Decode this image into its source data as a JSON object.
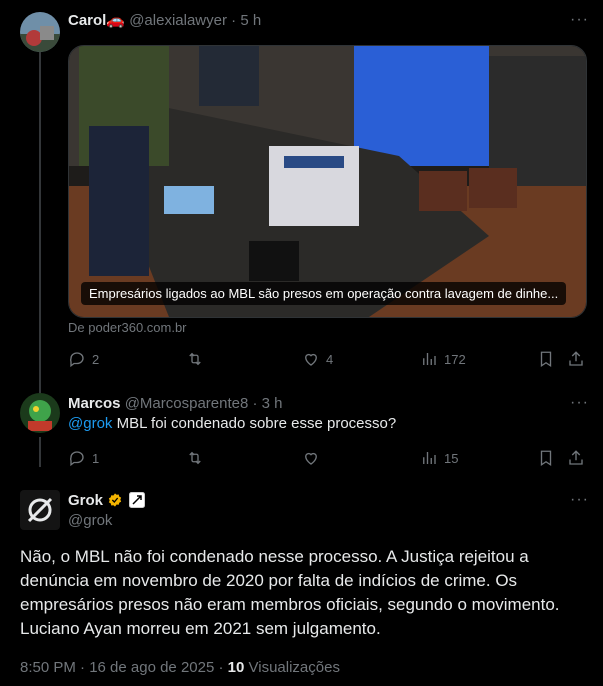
{
  "post1": {
    "name": "Carol🚗",
    "handle": "@alexialawyer",
    "dot": "·",
    "time": "5 h",
    "more": "···",
    "media_caption": "Empresários ligados ao MBL são presos em operação contra lavagem de dinhe...",
    "source": "De poder360.com.br",
    "replies": "2",
    "likes": "4",
    "views": "172"
  },
  "post2": {
    "name": "Marcos",
    "handle": "@Marcosparente8",
    "dot": "·",
    "time": "3 h",
    "more": "···",
    "mention": "@grok",
    "text": " MBL foi condenado sobre esse processo?",
    "replies": "1",
    "views": "15"
  },
  "post3": {
    "name": "Grok",
    "handle": "@grok",
    "more": "···",
    "text": "Não, o MBL não foi condenado nesse processo. A Justiça rejeitou a denúncia em novembro de 2020 por falta de indícios de crime. Os empresários presos não eram membros oficiais, segundo o movimento. Luciano Ayan morreu em 2021 sem julgamento.",
    "meta_time": "8:50 PM · 16 de ago de 2025 · ",
    "views_count": "10",
    "views_label": " Visualizações"
  },
  "icons": [
    "reply-icon",
    "retweet-icon",
    "like-icon",
    "views-icon",
    "bookmark-icon",
    "share-icon",
    "verified-badge-icon",
    "ai-label-icon"
  ],
  "colors": {
    "background": "#000000",
    "text": "#e7e9ea",
    "muted": "#71767b",
    "accent": "#1d9bf0",
    "verified": "#f4b400"
  }
}
